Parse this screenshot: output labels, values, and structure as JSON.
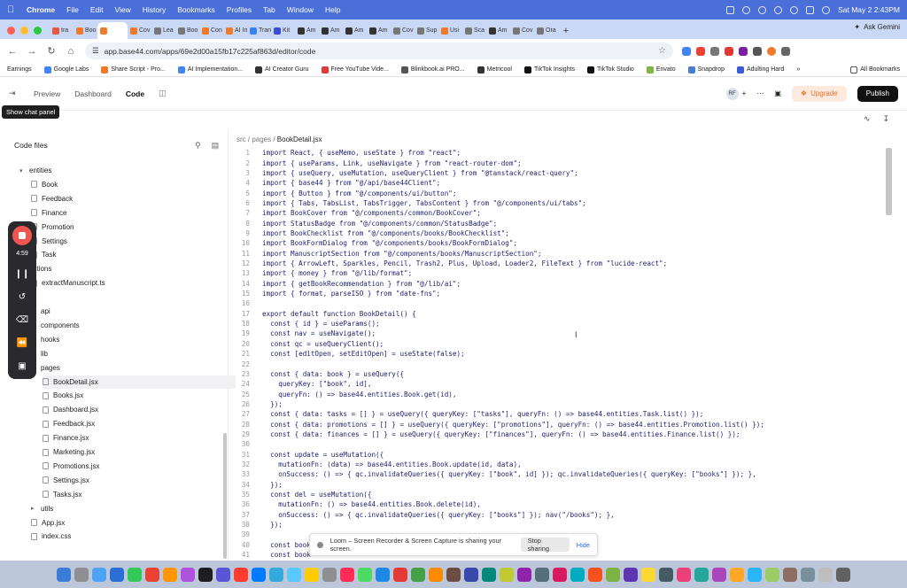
{
  "menubar": {
    "apple_icon": "apple-icon",
    "items": [
      "Chrome",
      "File",
      "Edit",
      "View",
      "History",
      "Bookmarks",
      "Profiles",
      "Tab",
      "Window",
      "Help"
    ],
    "clock": "Sat May 2  2:43PM"
  },
  "tabs": [
    {
      "label": "tra",
      "color": "#e8573f"
    },
    {
      "label": "Boo",
      "color": "#f07a2b"
    },
    {
      "label": "",
      "color": "#f07a2b",
      "active": true
    },
    {
      "label": "Cov",
      "color": "#f07a2b"
    },
    {
      "label": "Lea",
      "color": "#777777"
    },
    {
      "label": "Boo",
      "color": "#777777"
    },
    {
      "label": "Con",
      "color": "#f07a2b"
    },
    {
      "label": "AI Im",
      "color": "#f07a2b"
    },
    {
      "label": "Tran",
      "color": "#3b82f6"
    },
    {
      "label": "Kit",
      "color": "#3b4bd8"
    },
    {
      "label": "Am",
      "color": "#333333"
    },
    {
      "label": "Am",
      "color": "#333333"
    },
    {
      "label": "Am",
      "color": "#333333"
    },
    {
      "label": "Am",
      "color": "#333333"
    },
    {
      "label": "Cov",
      "color": "#777777"
    },
    {
      "label": "Sup",
      "color": "#777777"
    },
    {
      "label": "Usi",
      "color": "#f07a2b"
    },
    {
      "label": "Sca",
      "color": "#777777"
    },
    {
      "label": "Am",
      "color": "#333333"
    },
    {
      "label": "Cov",
      "color": "#777777"
    },
    {
      "label": "Ora",
      "color": "#777777"
    }
  ],
  "ask_gemini": "Ask Gemini",
  "address": {
    "url": "app.base44.com/apps/69e2d00a15fb17c225af863d/editor/code"
  },
  "bookmarks": [
    {
      "label": "Earnings",
      "color": ""
    },
    {
      "label": "Google Labs",
      "color": "#4285f4"
    },
    {
      "label": "Share Script - Pro...",
      "color": "#f07a2b"
    },
    {
      "label": "AI Implementation...",
      "color": "#4285f4"
    },
    {
      "label": "AI Creator Guru",
      "color": "#333333"
    },
    {
      "label": "Free YouTube Vide...",
      "color": "#e53935"
    },
    {
      "label": "Blinkbook.ai PRO...",
      "color": "#555555"
    },
    {
      "label": "Metricool",
      "color": "#333333"
    },
    {
      "label": "TikTok Insights",
      "color": "#111111"
    },
    {
      "label": "TikTok Studio",
      "color": "#111111"
    },
    {
      "label": "Envato",
      "color": "#81b441"
    },
    {
      "label": "Snapdrop",
      "color": "#4a7bd8"
    },
    {
      "label": "Adulting Hard",
      "color": "#3b5bd8"
    }
  ],
  "all_bookmarks": "All Bookmarks",
  "app": {
    "tabs": [
      "Preview",
      "Dashboard",
      "Code"
    ],
    "active_tab": "Code",
    "avatar": "RF",
    "upgrade": "Upgrade",
    "publish": "Publish",
    "tooltip": "Show chat panel"
  },
  "sidebar": {
    "title": "Code files",
    "tree": [
      {
        "label": "entities",
        "depth": 0,
        "type": "folder",
        "open": true
      },
      {
        "label": "Book",
        "depth": 1,
        "type": "file"
      },
      {
        "label": "Feedback",
        "depth": 1,
        "type": "file"
      },
      {
        "label": "Finance",
        "depth": 1,
        "type": "file"
      },
      {
        "label": "Promotion",
        "depth": 1,
        "type": "file"
      },
      {
        "label": "Settings",
        "depth": 1,
        "type": "file"
      },
      {
        "label": "Task",
        "depth": 1,
        "type": "file"
      },
      {
        "label": "nctions",
        "depth": 0,
        "type": "folder",
        "open": true
      },
      {
        "label": "extractManuscript.ts",
        "depth": 1,
        "type": "file"
      },
      {
        "label": "c",
        "depth": 0,
        "type": "folder",
        "open": true
      },
      {
        "label": "api",
        "depth": 1,
        "type": "folder"
      },
      {
        "label": "components",
        "depth": 1,
        "type": "folder"
      },
      {
        "label": "hooks",
        "depth": 1,
        "type": "folder"
      },
      {
        "label": "lib",
        "depth": 1,
        "type": "folder"
      },
      {
        "label": "pages",
        "depth": 1,
        "type": "folder",
        "open": true
      },
      {
        "label": "BookDetail.jsx",
        "depth": 2,
        "type": "file",
        "selected": true
      },
      {
        "label": "Books.jsx",
        "depth": 2,
        "type": "file"
      },
      {
        "label": "Dashboard.jsx",
        "depth": 2,
        "type": "file"
      },
      {
        "label": "Feedback.jsx",
        "depth": 2,
        "type": "file"
      },
      {
        "label": "Finance.jsx",
        "depth": 2,
        "type": "file"
      },
      {
        "label": "Marketing.jsx",
        "depth": 2,
        "type": "file"
      },
      {
        "label": "Promotions.jsx",
        "depth": 2,
        "type": "file"
      },
      {
        "label": "Settings.jsx",
        "depth": 2,
        "type": "file"
      },
      {
        "label": "Tasks.jsx",
        "depth": 2,
        "type": "file"
      },
      {
        "label": "utils",
        "depth": 1,
        "type": "folder"
      },
      {
        "label": "App.jsx",
        "depth": 1,
        "type": "file"
      },
      {
        "label": "index.css",
        "depth": 1,
        "type": "file"
      }
    ]
  },
  "loom": {
    "time": "4:59",
    "banner_text": "Loom – Screen Recorder & Screen Capture is sharing your screen.",
    "stop": "Stop sharing",
    "hide": "Hide"
  },
  "editor": {
    "breadcrumb_prefix": "src / pages / ",
    "breadcrumb_file": "BookDetail.jsx",
    "lines": [
      "import React, { useMemo, useState } from \"react\";",
      "import { useParams, Link, useNavigate } from \"react-router-dom\";",
      "import { useQuery, useMutation, useQueryClient } from \"@tanstack/react-query\";",
      "import { base44 } from \"@/api/base44Client\";",
      "import { Button } from \"@/components/ui/button\";",
      "import { Tabs, TabsList, TabsTrigger, TabsContent } from \"@/components/ui/tabs\";",
      "import BookCover from \"@/components/common/BookCover\";",
      "import StatusBadge from \"@/components/common/StatusBadge\";",
      "import BookChecklist from \"@/components/books/BookChecklist\";",
      "import BookFormDialog from \"@/components/books/BookFormDialog\";",
      "import ManuscriptSection from \"@/components/books/ManuscriptSection\";",
      "import { ArrowLeft, Sparkles, Pencil, Trash2, Plus, Upload, Loader2, FileText } from \"lucide-react\";",
      "import { money } from \"@/lib/format\";",
      "import { getBookRecommendation } from \"@/lib/ai\";",
      "import { format, parseISO } from \"date-fns\";",
      "",
      "export default function BookDetail() {",
      "  const { id } = useParams();",
      "  const nav = useNavigate();",
      "  const qc = useQueryClient();",
      "  const [editOpen, setEditOpen] = useState(false);",
      "",
      "  const { data: book } = useQuery({",
      "    queryKey: [\"book\", id],",
      "    queryFn: () => base44.entities.Book.get(id),",
      "  });",
      "  const { data: tasks = [] } = useQuery({ queryKey: [\"tasks\"], queryFn: () => base44.entities.Task.list() });",
      "  const { data: promotions = [] } = useQuery({ queryKey: [\"promotions\"], queryFn: () => base44.entities.Promotion.list() });",
      "  const { data: finances = [] } = useQuery({ queryKey: [\"finances\"], queryFn: () => base44.entities.Finance.list() });",
      "",
      "  const update = useMutation({",
      "    mutationFn: (data) => base44.entities.Book.update(id, data),",
      "    onSuccess: () => { qc.invalidateQueries({ queryKey: [\"book\", id] }); qc.invalidateQueries({ queryKey: [\"books\"] }); },",
      "  });",
      "  const del = useMutation({",
      "    mutationFn: () => base44.entities.Book.delete(id),",
      "    onSuccess: () => { qc.invalidateQueries({ queryKey: [\"books\"] }); nav(\"/books\"); },",
      "  });",
      "",
      "  const book",
      "  const book"
    ]
  },
  "dock_colors": [
    "#3a7bd5",
    "#8e8e93",
    "#4fa3f7",
    "#2b6fd6",
    "#34c759",
    "#ea4335",
    "#ff9500",
    "#af52de",
    "#1d1d1f",
    "#5856d6",
    "#ff3b30",
    "#007aff",
    "#34aadc",
    "#5ac8fa",
    "#ffcc00",
    "#8e8e93",
    "#ff2d55",
    "#4cd964",
    "#1e88e5",
    "#e53935",
    "#43a047",
    "#fb8c00",
    "#6d4c41",
    "#3949ab",
    "#00897b",
    "#c0ca33",
    "#8e24aa",
    "#546e7a",
    "#d81b60",
    "#00acc1",
    "#f4511e",
    "#7cb342",
    "#5e35b1",
    "#fdd835",
    "#455a64",
    "#ec407a",
    "#26a69a",
    "#ab47bc",
    "#ffa726",
    "#29b6f6",
    "#9ccc65",
    "#8d6e63",
    "#78909c",
    "#bdbdbd",
    "#616161"
  ]
}
